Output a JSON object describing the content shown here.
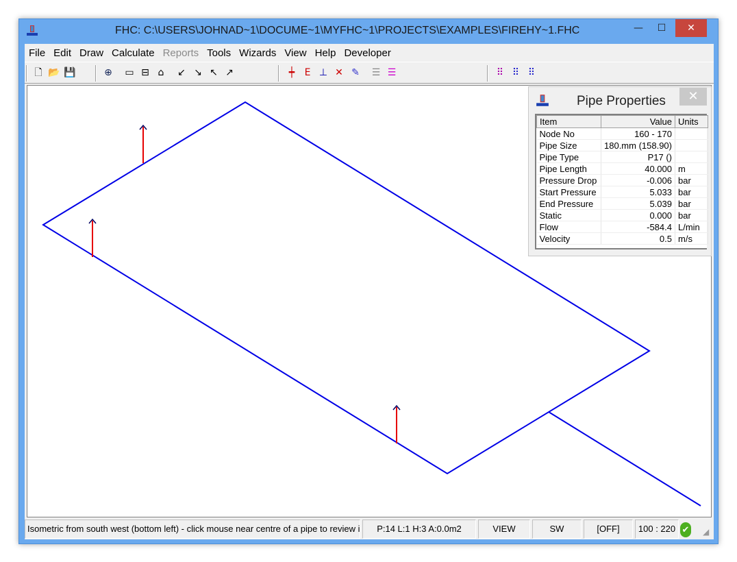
{
  "window": {
    "title": "FHC: C:\\USERS\\JOHNAD~1\\DOCUME~1\\MYFHC~1\\PROJECTS\\EXAMPLES\\FIREHY~1.FHC",
    "minimize": "—",
    "maximize": "☐",
    "close": "✕"
  },
  "menu": [
    "File",
    "Edit",
    "Draw",
    "Calculate",
    "Reports",
    "Tools",
    "Wizards",
    "View",
    "Help",
    "Developer"
  ],
  "menu_disabled": [
    "Reports"
  ],
  "toolbar_icons": [
    "new-file-icon",
    "open-folder-icon",
    "save-icon",
    "zoom-icon",
    "rectangle-icon",
    "split-rectangle-icon",
    "house-icon",
    "arrow-sw-icon",
    "arrow-se-icon",
    "arrow-nw-icon",
    "arrow-ne-icon",
    "add-node-icon",
    "add-e-node-icon",
    "add-tee-icon",
    "delete-node-icon",
    "edit-pen-icon",
    "layers-icon",
    "list-icon",
    "grid-dots-icon",
    "grid-select-icon",
    "grid-outline-icon"
  ],
  "pipe_properties": {
    "title": "Pipe Properties",
    "close": "✕",
    "headers": [
      "Item",
      "Value",
      "Units"
    ],
    "rows": [
      [
        "Node No",
        "160 - 170",
        ""
      ],
      [
        "Pipe Size",
        "180.mm (158.90)",
        ""
      ],
      [
        "Pipe Type",
        "P17 ()",
        ""
      ],
      [
        "Pipe Length",
        "40.000",
        "m"
      ],
      [
        "Pressure Drop",
        "-0.006",
        "bar"
      ],
      [
        "Start Pressure",
        "5.033",
        "bar"
      ],
      [
        "End Pressure",
        "5.039",
        "bar"
      ],
      [
        "Static",
        "0.000",
        "bar"
      ],
      [
        "Flow",
        "-584.4",
        "L/min"
      ],
      [
        "Velocity",
        "0.5",
        "m/s"
      ]
    ]
  },
  "status": {
    "message": "Isometric from south west (bottom left) - click mouse near centre of a pipe to review i",
    "counts": "P:14 L:1 H:3 A:0.0m2",
    "mode": "VIEW",
    "direction": "SW",
    "toggle": "[OFF]",
    "scale": "100 : 220"
  },
  "colors": {
    "pipe": "#0000e6",
    "riser": "#e60000",
    "title_bar": "#6aa9ee",
    "ok": "#4caf20"
  }
}
